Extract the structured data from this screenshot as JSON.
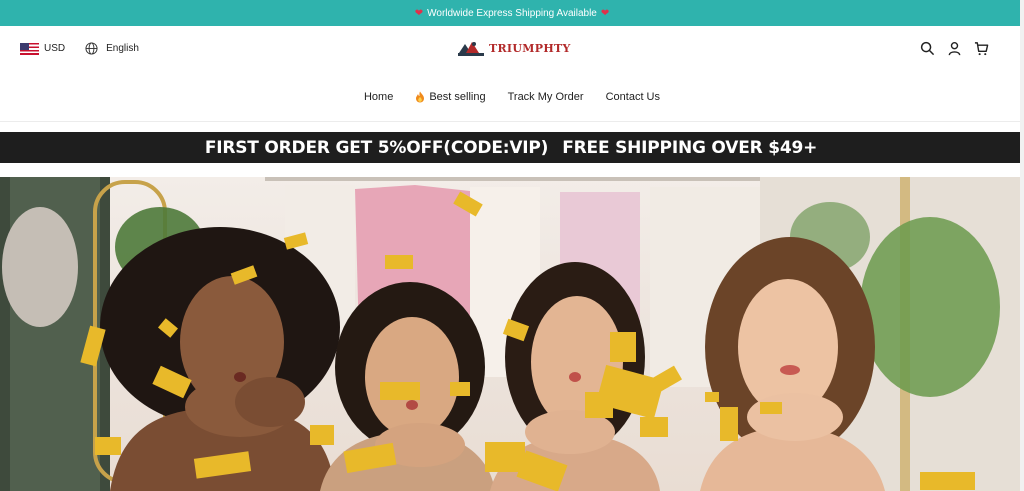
{
  "announcement": {
    "text": "Worldwide Express Shipping Available",
    "heart_icon": "heart-icon"
  },
  "header": {
    "currency": "USD",
    "language": "English",
    "logo_text": "TRIUMPHTY",
    "icons": [
      "search-icon",
      "user-icon",
      "cart-icon"
    ]
  },
  "nav": {
    "items": [
      {
        "label": "Home"
      },
      {
        "label": "Best selling",
        "icon": "fire-icon"
      },
      {
        "label": "Track My Order"
      },
      {
        "label": "Contact Us"
      }
    ]
  },
  "promo": {
    "part1": "FIRST ORDER GET 5%OFF(CODE:VIP)",
    "part2": "FREE SHIPPING OVER $49+"
  },
  "colors": {
    "announcement_bg": "#2fb3ad",
    "promo_bg": "#1e1e1e",
    "logo_red": "#b22a2a",
    "confetti_gold": "#e8b92a"
  }
}
